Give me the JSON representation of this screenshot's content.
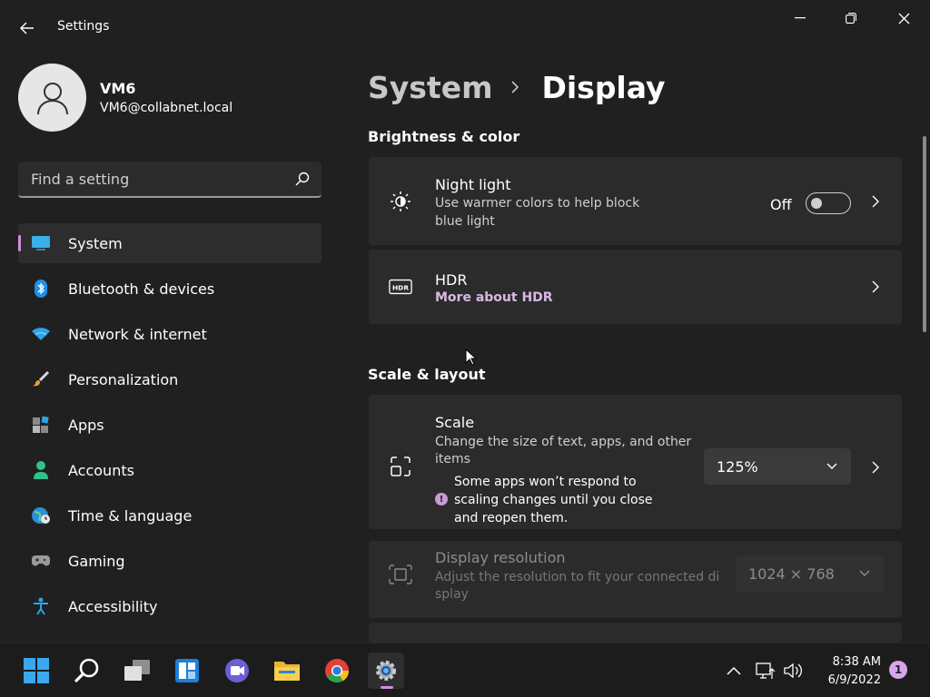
{
  "window": {
    "title": "Settings"
  },
  "profile": {
    "name": "VM6",
    "email": "VM6@collabnet.local"
  },
  "search": {
    "placeholder": "Find a setting"
  },
  "nav": [
    {
      "label": "System",
      "icon": "system-icon",
      "selected": true
    },
    {
      "label": "Bluetooth & devices",
      "icon": "bluetooth-icon"
    },
    {
      "label": "Network & internet",
      "icon": "wifi-icon"
    },
    {
      "label": "Personalization",
      "icon": "brush-icon"
    },
    {
      "label": "Apps",
      "icon": "apps-icon"
    },
    {
      "label": "Accounts",
      "icon": "person-icon"
    },
    {
      "label": "Time & language",
      "icon": "globe-clock-icon"
    },
    {
      "label": "Gaming",
      "icon": "gamepad-icon"
    },
    {
      "label": "Accessibility",
      "icon": "accessibility-icon"
    }
  ],
  "breadcrumb": {
    "parent": "System",
    "current": "Display"
  },
  "sections": {
    "brightness": "Brightness & color",
    "scale_layout": "Scale & layout"
  },
  "night_light": {
    "title": "Night light",
    "desc_line1": "Use warmer colors to help block",
    "desc_line2": "blue light",
    "state": "Off"
  },
  "hdr": {
    "title": "HDR",
    "link": "More about HDR"
  },
  "scale": {
    "title": "Scale",
    "desc_line1": "Change the size of text, apps, and other",
    "desc_line2": "items",
    "info_line1": "Some apps won’t respond to",
    "info_line2": "scaling changes until you close",
    "info_line3": "and reopen them.",
    "value": "125%"
  },
  "resolution": {
    "title": "Display resolution",
    "desc_line1": "Adjust the resolution to fit your connected di",
    "desc_line2": "splay",
    "value": "1024 × 768"
  },
  "taskbar": {
    "time": "8:38 AM",
    "date": "6/9/2022",
    "notifications": "1"
  },
  "colors": {
    "accent": "#d08fe0",
    "background": "#202020",
    "card": "#2b2b2b"
  }
}
